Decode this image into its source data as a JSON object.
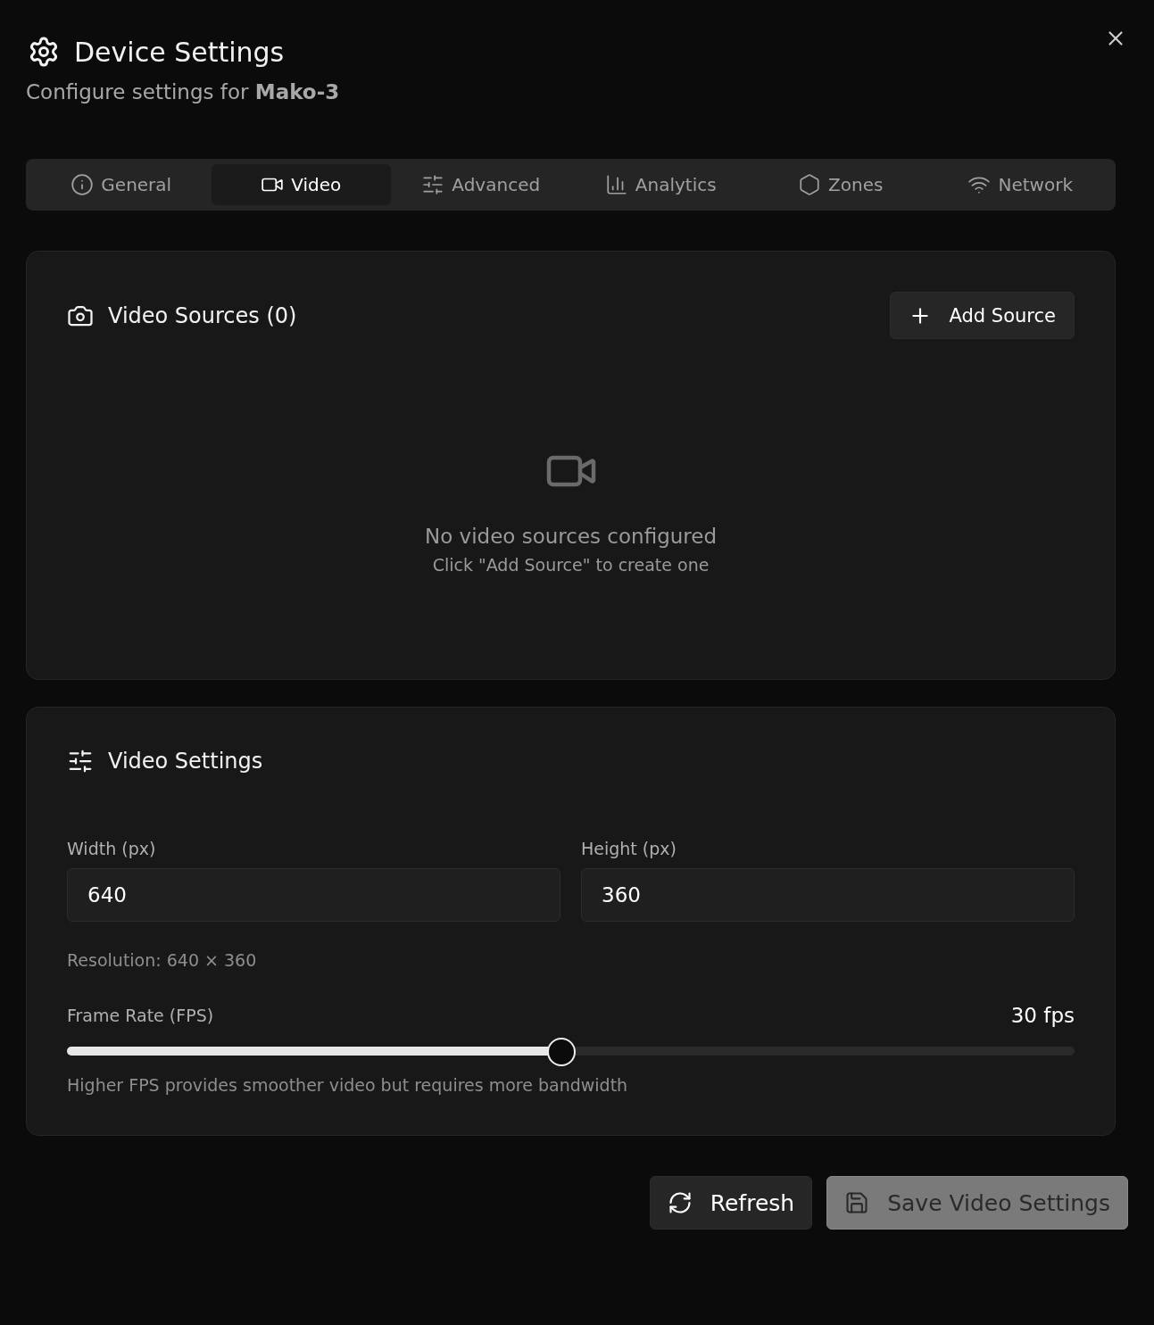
{
  "dialog": {
    "title": "Device Settings",
    "subtitle": "Configure settings for **Mako-3**"
  },
  "tabs": [
    {
      "label": "General",
      "selected": false
    },
    {
      "label": "Video",
      "selected": true
    },
    {
      "label": "Advanced",
      "selected": false
    },
    {
      "label": "Analytics",
      "selected": false
    },
    {
      "label": "Zones",
      "selected": false
    },
    {
      "label": "Network",
      "selected": false
    }
  ],
  "sources_panel": {
    "title": "Video Sources (0)",
    "add_button": "Add Source",
    "empty_title": "No video sources configured",
    "empty_hint": "Click \"Add Source\" to create one"
  },
  "settings_panel": {
    "title": "Video Settings",
    "fields": [
      {
        "label": "Width (px)",
        "value": "640"
      },
      {
        "label": "Height (px)",
        "value": "360"
      }
    ],
    "resolution": "Resolution: 640 × 360",
    "frame_rate": {
      "label": "Frame Rate (FPS)",
      "reading": "30 fps",
      "level": 0.49,
      "hint": "Higher FPS provides smoother video but requires more bandwidth"
    }
  },
  "buttons": [
    {
      "label": "Refresh",
      "disabled": false
    },
    {
      "label": "Save Video Settings",
      "disabled": true
    }
  ]
}
